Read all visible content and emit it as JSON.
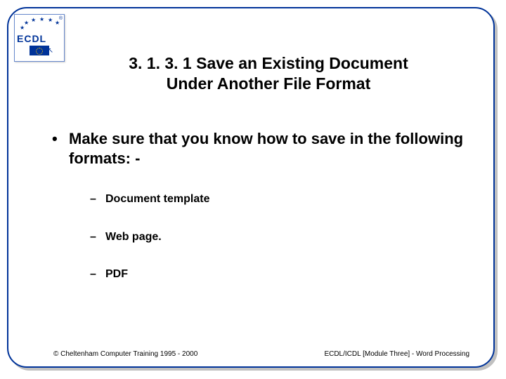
{
  "logo": {
    "word": "ECDL",
    "registered": "®"
  },
  "title": {
    "line1": "3. 1. 3. 1 Save an Existing Document",
    "line2": "Under Another File Format"
  },
  "bullets": {
    "main": "Make sure that you know how to save in the following formats: -",
    "subs": [
      "Document template",
      "Web page.",
      "PDF"
    ]
  },
  "footer": {
    "left": "© Cheltenham Computer Training 1995 - 2000",
    "right": "ECDL/ICDL [Module Three]  - Word Processing"
  }
}
